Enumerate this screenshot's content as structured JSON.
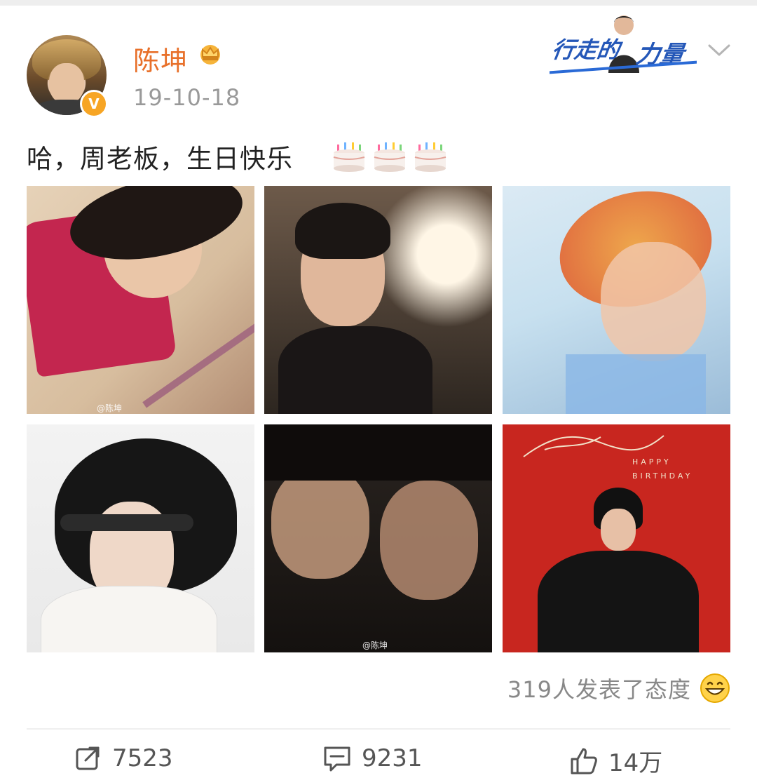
{
  "post": {
    "username": "陈坤",
    "timestamp": "19-10-18",
    "text": "哈，周老板，生日快乐",
    "emojis": [
      "birthday-cake",
      "birthday-cake",
      "birthday-cake"
    ],
    "badge": "V"
  },
  "banner": {
    "text_left": "行走的",
    "text_right": "力量"
  },
  "photos": [
    {
      "watermark": "@陈坤"
    },
    {
      "watermark": ""
    },
    {
      "watermark": ""
    },
    {
      "watermark": ""
    },
    {
      "watermark": "@陈坤"
    },
    {
      "overlay_text": "HAPPY BIRTHDAY"
    }
  ],
  "reactions": {
    "text": "319人发表了态度",
    "emoji": "grinning-face"
  },
  "actions": {
    "repost": "7523",
    "comment": "9231",
    "like": "14万"
  },
  "colors": {
    "username": "#e8702a",
    "timestamp": "#999999",
    "text": "#222222",
    "brand_blue": "#2457b8"
  }
}
